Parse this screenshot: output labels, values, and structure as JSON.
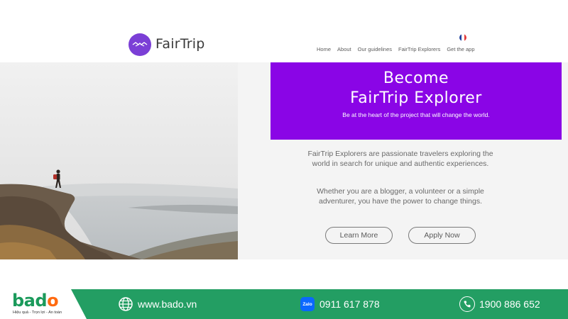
{
  "header": {
    "brand": "FairTrip",
    "nav": [
      "Home",
      "About",
      "Our guidelines",
      "FairTrip Explorers",
      "Get the app"
    ],
    "language_flag": "french-flag-icon"
  },
  "banner": {
    "title_line1": "Become",
    "title_line2": "FairTrip Explorer",
    "subtitle": "Be at the heart of the project that will change the world.",
    "color": "#8a05e6"
  },
  "content": {
    "paragraph1": "FairTrip Explorers are passionate travelers exploring the world in search for unique and authentic experiences.",
    "paragraph2": "Whether you are a blogger, a volunteer or a simple adventurer, you have the power to change things.",
    "learn_more": "Learn More",
    "apply_now": "Apply Now"
  },
  "footer": {
    "logo_text_main": "bad",
    "logo_text_o": "o",
    "tagline": "Hiệu quả - Trọn lợi - An toàn",
    "website": "www.bado.vn",
    "zalo_label": "Zalo",
    "zalo_phone": "0911 617 878",
    "hotline": "1900 886 652",
    "color": "#239e63"
  }
}
